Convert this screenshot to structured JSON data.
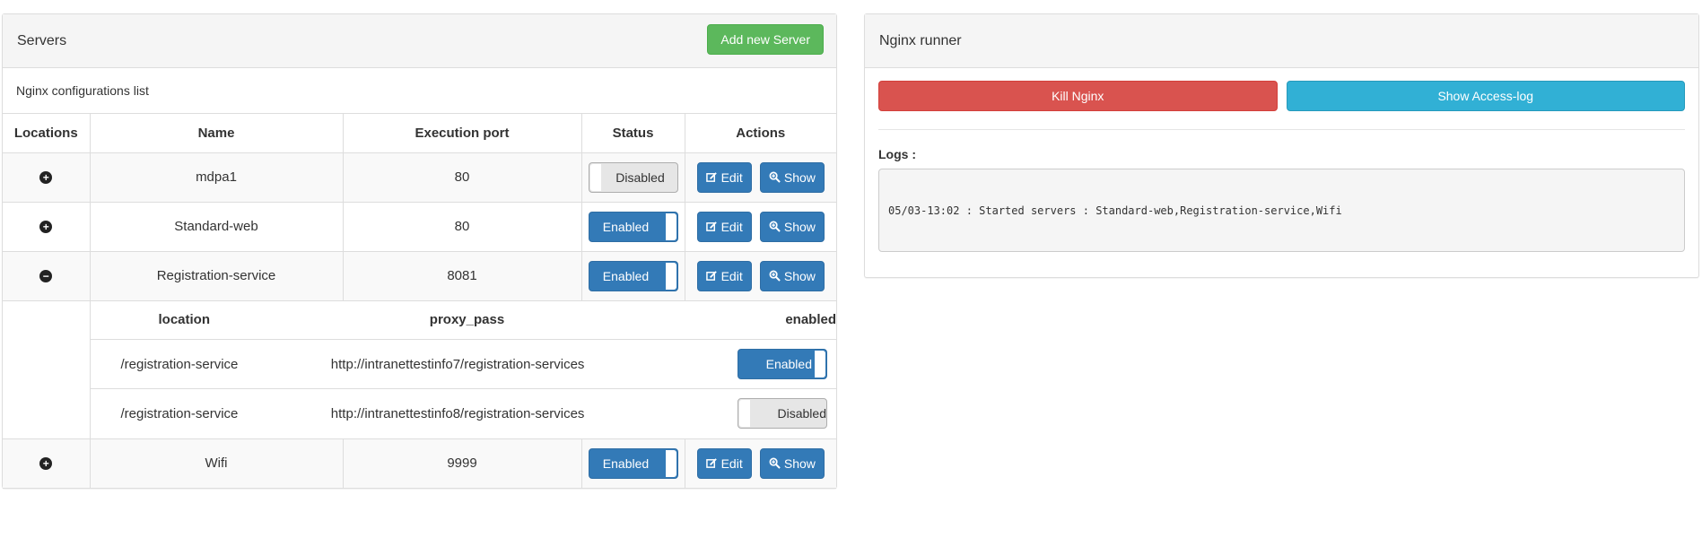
{
  "servers_panel": {
    "title": "Servers",
    "add_button": "Add new Server",
    "subtitle": "Nginx configurations list",
    "columns": [
      "Locations",
      "Name",
      "Execution port",
      "Status",
      "Actions"
    ],
    "edit_label": "Edit",
    "show_label": "Show",
    "rows": [
      {
        "name": "mdpa1",
        "port": "80",
        "status": "Disabled",
        "expanded": false
      },
      {
        "name": "Standard-web",
        "port": "80",
        "status": "Enabled",
        "expanded": false
      },
      {
        "name": "Registration-service",
        "port": "8081",
        "status": "Enabled",
        "expanded": true
      },
      {
        "name": "Wifi",
        "port": "9999",
        "status": "Enabled",
        "expanded": false
      }
    ],
    "locations": {
      "columns": [
        "location",
        "proxy_pass",
        "enabled"
      ],
      "rows": [
        {
          "location": "/registration-service",
          "proxy_pass": "http://intranettestinfo7/registration-services",
          "enabled": "Enabled"
        },
        {
          "location": "/registration-service",
          "proxy_pass": "http://intranettestinfo8/registration-services",
          "enabled": "Disabled"
        }
      ]
    }
  },
  "nginx_panel": {
    "title": "Nginx runner",
    "kill_button": "Kill Nginx",
    "access_log_button": "Show Access-log",
    "logs_label": "Logs :",
    "log_text": "05/03-13:02 : Started servers : Standard-web,Registration-service,Wifi"
  },
  "icons": {
    "expand": "plus-circle-icon",
    "collapse": "minus-circle-icon",
    "edit": "edit-icon",
    "show": "zoom-in-icon"
  },
  "colors": {
    "primary": "#337ab7",
    "success": "#5cb85c",
    "danger": "#d9534f",
    "info": "#31b0d5"
  }
}
